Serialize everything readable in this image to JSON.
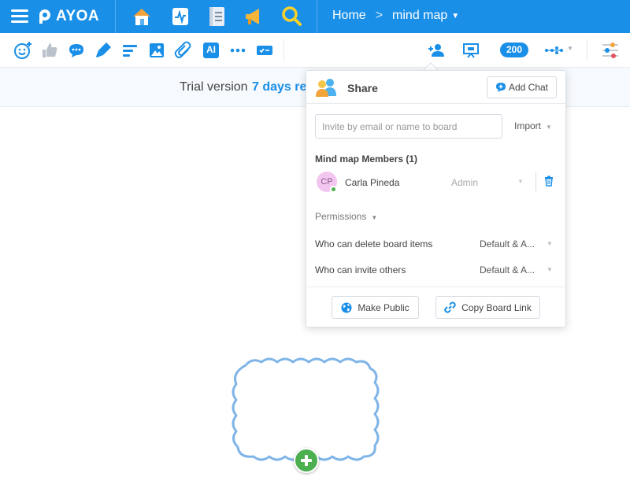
{
  "app": {
    "brand": "AYOA",
    "accent_color": "#1a8fe8"
  },
  "header": {
    "app_icons": [
      "home-icon",
      "activity-icon",
      "notebook-icon",
      "megaphone-icon",
      "search-icon"
    ],
    "breadcrumb": {
      "home": "Home",
      "separator": ">",
      "current": "mind map"
    }
  },
  "toolbar": {
    "icons": [
      "emoji-icon",
      "thumbs-up-icon",
      "comment-icon",
      "pen-icon",
      "text-align-icon",
      "image-icon",
      "attachment-icon",
      "ai-icon",
      "more-icon",
      "card-icon",
      "add-user-icon",
      "presentation-icon",
      "layout-icon",
      "settings-sliders-icon"
    ],
    "ai_label": "AI",
    "counter": "200"
  },
  "trial": {
    "text": "Trial version",
    "days": "7 days re"
  },
  "share": {
    "title": "Share",
    "add_chat_label": "Add Chat",
    "invite_placeholder": "Invite by email or name to board",
    "import_label": "Import",
    "members_title": "Mind map Members (1)",
    "members": [
      {
        "initials": "CP",
        "name": "Carla Pineda",
        "role": "Admin",
        "online": true
      }
    ],
    "permissions_label": "Permissions",
    "permissions": [
      {
        "label": "Who can delete board items",
        "value": "Default & A..."
      },
      {
        "label": "Who can invite others",
        "value": "Default & A..."
      }
    ],
    "make_public_label": "Make Public",
    "copy_link_label": "Copy Board Link"
  }
}
